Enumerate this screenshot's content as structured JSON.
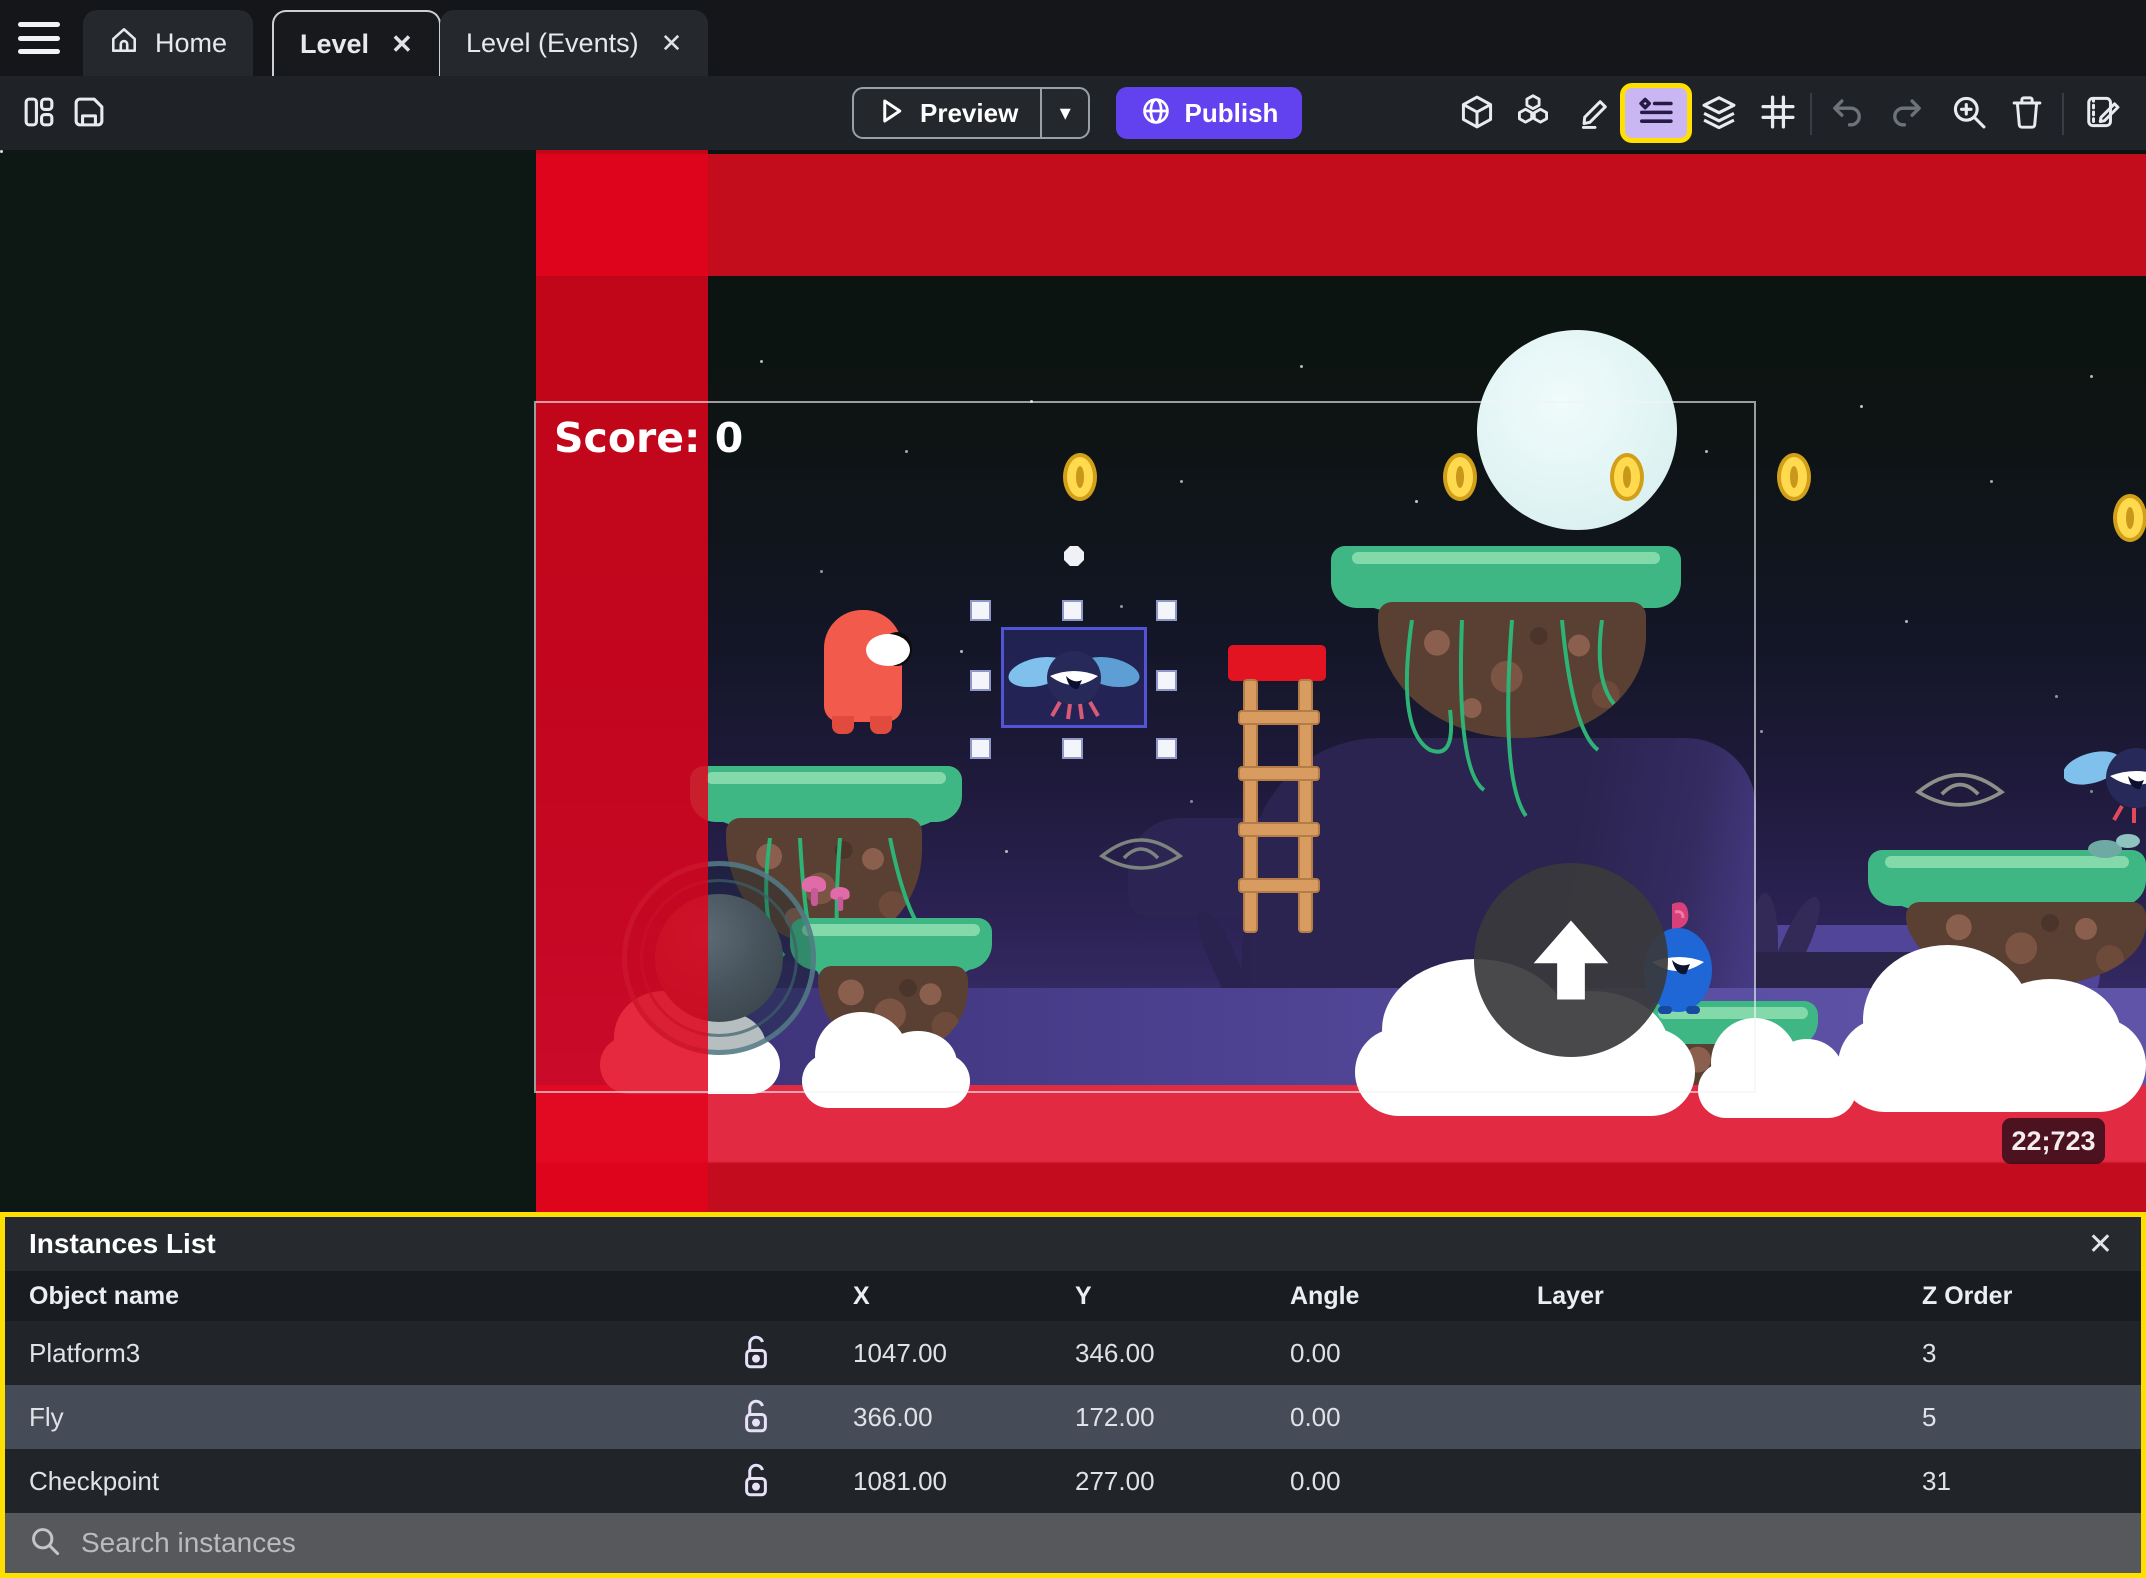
{
  "tabbar": {
    "tabs": [
      {
        "label": "Home"
      },
      {
        "label": "Level"
      },
      {
        "label": "Level (Events)"
      }
    ]
  },
  "toolbar": {
    "preview_label": "Preview",
    "publish_label": "Publish"
  },
  "icons": {
    "close": "✕",
    "chevron_down": "▾"
  },
  "canvas": {
    "score_label": "Score: 0",
    "coords_badge": "22;723"
  },
  "panel": {
    "title": "Instances List",
    "columns": {
      "name": "Object name",
      "x": "X",
      "y": "Y",
      "angle": "Angle",
      "layer": "Layer",
      "z": "Z Order"
    },
    "rows": [
      {
        "name": "Platform3",
        "x": "1047.00",
        "y": "346.00",
        "angle": "0.00",
        "layer": "",
        "z": "3"
      },
      {
        "name": "Fly",
        "x": "366.00",
        "y": "172.00",
        "angle": "0.00",
        "layer": "",
        "z": "5"
      },
      {
        "name": "Checkpoint",
        "x": "1081.00",
        "y": "277.00",
        "angle": "0.00",
        "layer": "",
        "z": "31"
      }
    ],
    "search_placeholder": "Search instances"
  },
  "colors": {
    "accent_purple": "#6242ee",
    "highlight_yellow": "#ffdf00",
    "selection_blue": "#5353d6",
    "danger_band_red": "#d9041c"
  }
}
